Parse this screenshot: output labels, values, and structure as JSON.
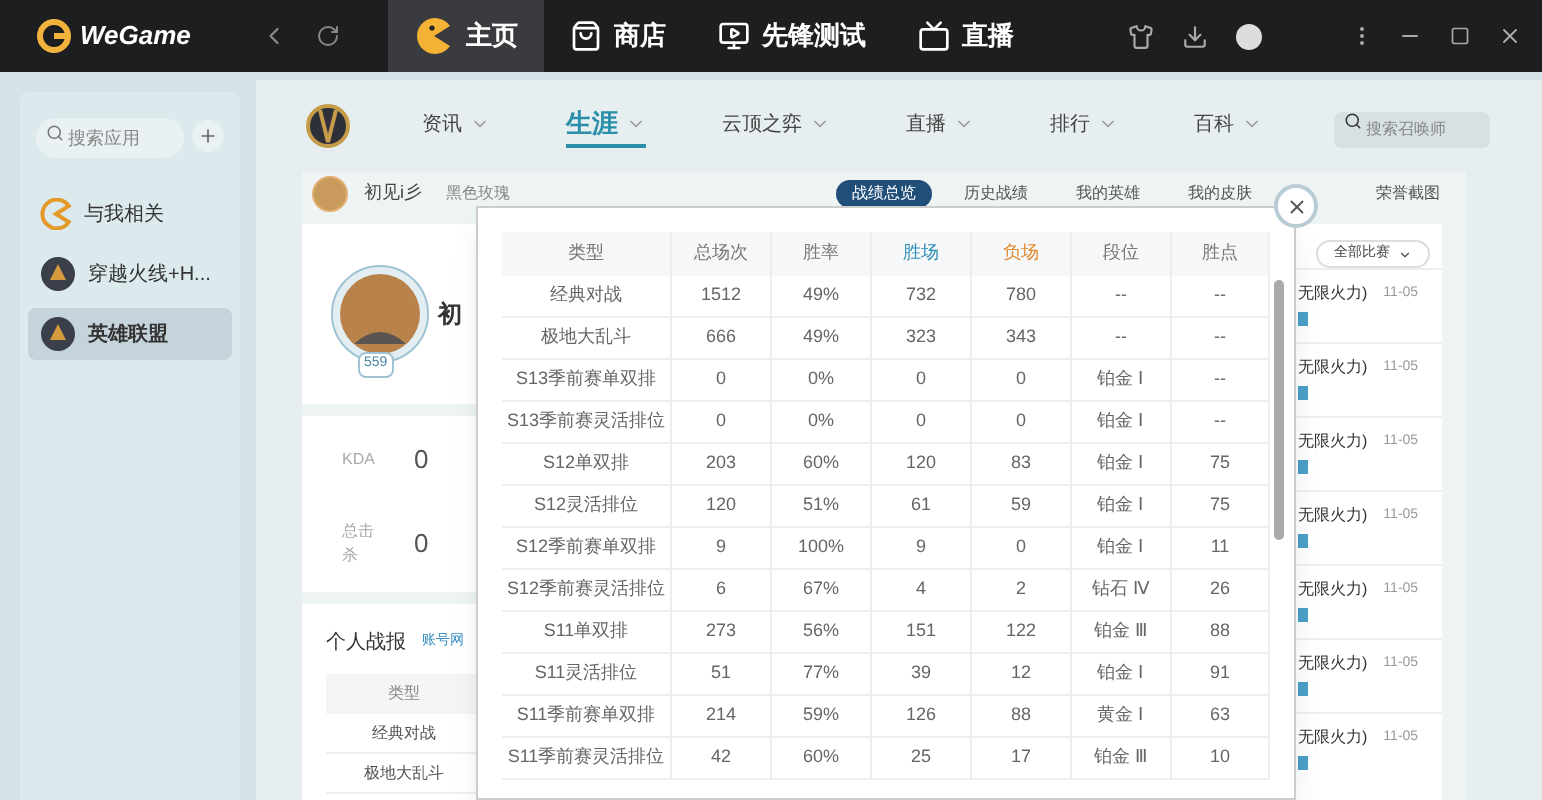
{
  "app": {
    "logo": "WeGame"
  },
  "nav_tabs": [
    {
      "label": "主页",
      "kind": "home",
      "selected": true
    },
    {
      "label": "商店",
      "kind": "shop",
      "selected": false
    },
    {
      "label": "先锋测试",
      "kind": "test",
      "selected": false
    },
    {
      "label": "直播",
      "kind": "live",
      "selected": false
    }
  ],
  "sidebar": {
    "search": {
      "placeholder": "搜索应用"
    },
    "items": [
      {
        "label": "与我相关",
        "kind": "mine",
        "selected": false
      },
      {
        "label": "穿越火线+H...",
        "kind": "game",
        "selected": false
      },
      {
        "label": "英雄联盟",
        "kind": "game",
        "selected": true
      }
    ]
  },
  "game_nav": {
    "items": [
      {
        "label": "资讯",
        "selected": false
      },
      {
        "label": "生涯",
        "selected": true
      },
      {
        "label": "云顶之弈",
        "selected": false
      },
      {
        "label": "直播",
        "selected": false
      },
      {
        "label": "排行",
        "selected": false
      },
      {
        "label": "百科",
        "selected": false
      }
    ],
    "search": {
      "placeholder": "搜索召唤师"
    }
  },
  "profile": {
    "name": "初见i彡",
    "server": "黑色玫瑰",
    "tabs": [
      {
        "label": "战绩总览",
        "selected": true
      },
      {
        "label": "历史战绩",
        "selected": false
      },
      {
        "label": "我的英雄",
        "selected": false
      },
      {
        "label": "我的皮肤",
        "selected": false
      },
      {
        "label": "荣誉截图",
        "selected": false
      }
    ]
  },
  "card": {
    "level": "559",
    "name": "初"
  },
  "stats": [
    {
      "label": "KDA",
      "value": "0"
    },
    {
      "label": "总击杀",
      "value": "0"
    }
  ],
  "report": {
    "title": "个人战报",
    "link": "账号网",
    "columns": [
      "类型"
    ],
    "rows": [
      "经典对战",
      "极地大乱斗"
    ]
  },
  "match_filter": "全部比赛",
  "matches": [
    {
      "mode": "无限火力)",
      "date": "11-05"
    },
    {
      "mode": "无限火力)",
      "date": "11-05"
    },
    {
      "mode": "无限火力)",
      "date": "11-05"
    },
    {
      "mode": "无限火力)",
      "date": "11-05"
    },
    {
      "mode": "无限火力)",
      "date": "11-05"
    },
    {
      "mode": "无限火力)",
      "date": "11-05"
    },
    {
      "mode": "无限火力)",
      "date": "11-05"
    }
  ],
  "modal": {
    "columns": [
      {
        "label": "类型",
        "color": "#777777"
      },
      {
        "label": "总场次",
        "color": "#777777"
      },
      {
        "label": "胜率",
        "color": "#777777"
      },
      {
        "label": "胜场",
        "color": "#2f8fb5"
      },
      {
        "label": "负场",
        "color": "#e0892e"
      },
      {
        "label": "段位",
        "color": "#777777"
      },
      {
        "label": "胜点",
        "color": "#777777"
      }
    ],
    "rows": [
      [
        "经典对战",
        "1512",
        "49%",
        "732",
        "780",
        "--",
        "--"
      ],
      [
        "极地大乱斗",
        "666",
        "49%",
        "323",
        "343",
        "--",
        "--"
      ],
      [
        "S13季前赛单双排",
        "0",
        "0%",
        "0",
        "0",
        "铂金 Ⅰ",
        "--"
      ],
      [
        "S13季前赛灵活排位",
        "0",
        "0%",
        "0",
        "0",
        "铂金 Ⅰ",
        "--"
      ],
      [
        "S12单双排",
        "203",
        "60%",
        "120",
        "83",
        "铂金 Ⅰ",
        "75"
      ],
      [
        "S12灵活排位",
        "120",
        "51%",
        "61",
        "59",
        "铂金 Ⅰ",
        "75"
      ],
      [
        "S12季前赛单双排",
        "9",
        "100%",
        "9",
        "0",
        "铂金 Ⅰ",
        "11"
      ],
      [
        "S12季前赛灵活排位",
        "6",
        "67%",
        "4",
        "2",
        "钻石 Ⅳ",
        "26"
      ],
      [
        "S11单双排",
        "273",
        "56%",
        "151",
        "122",
        "铂金 Ⅲ",
        "88"
      ],
      [
        "S11灵活排位",
        "51",
        "77%",
        "39",
        "12",
        "铂金 Ⅰ",
        "91"
      ],
      [
        "S11季前赛单双排",
        "214",
        "59%",
        "126",
        "88",
        "黄金 Ⅰ",
        "63"
      ],
      [
        "S11季前赛灵活排位",
        "42",
        "60%",
        "25",
        "17",
        "铂金 Ⅲ",
        "10"
      ]
    ]
  }
}
